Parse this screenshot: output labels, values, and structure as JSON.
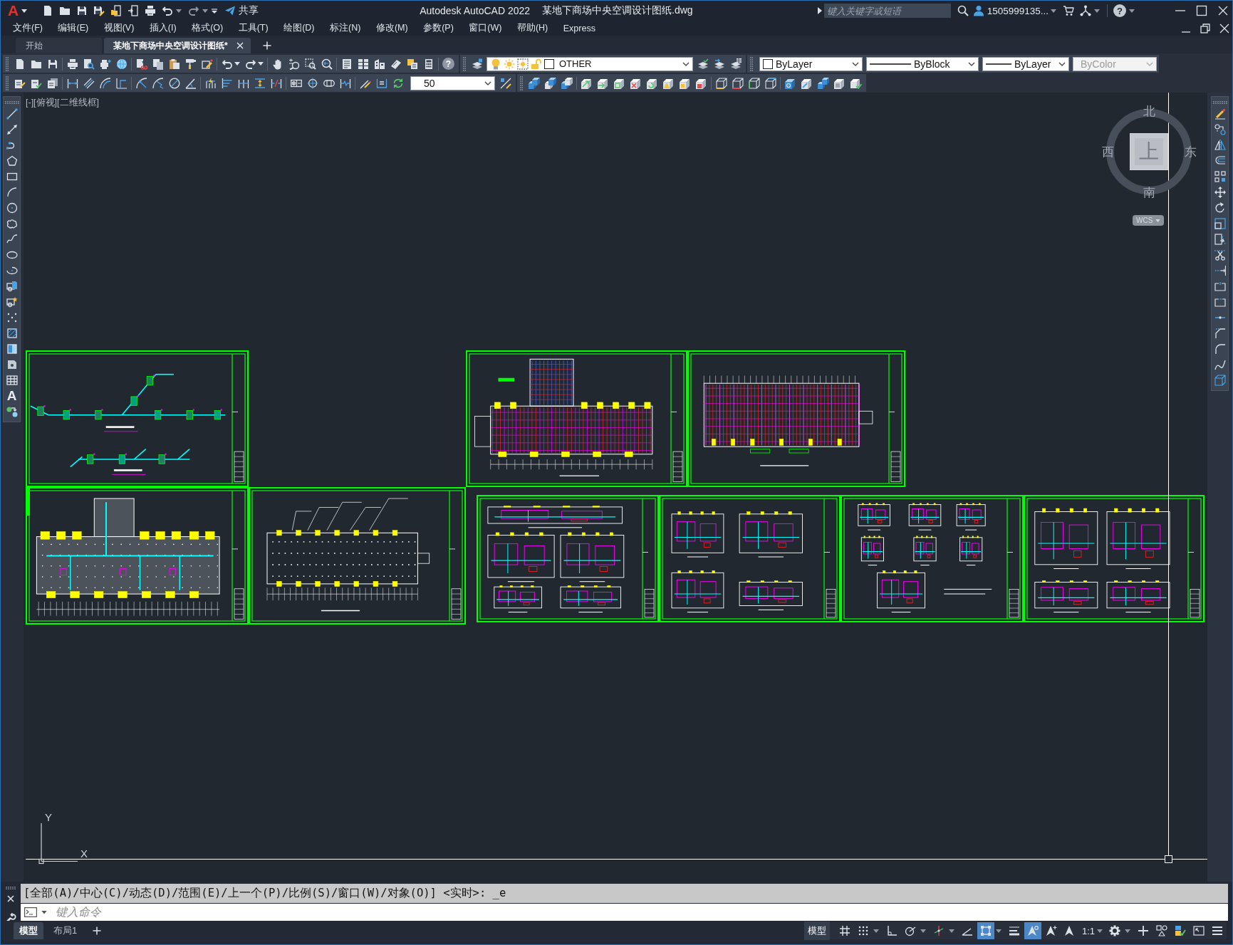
{
  "title_bar": {
    "logo": "A",
    "share_label": "共享",
    "app_name": "Autodesk AutoCAD 2022",
    "file_name": "某地下商场中央空调设计图纸.dwg",
    "search": {
      "placeholder": "键入关键字或短语"
    },
    "user_name": "1505999135...",
    "help": "?"
  },
  "menu_bar": [
    "文件(F)",
    "编辑(E)",
    "视图(V)",
    "插入(I)",
    "格式(O)",
    "工具(T)",
    "绘图(D)",
    "标注(N)",
    "修改(M)",
    "参数(P)",
    "窗口(W)",
    "帮助(H)",
    "Express"
  ],
  "document_tabs": [
    {
      "label": "开始",
      "selected": false
    },
    {
      "label": "某地下商场中央空调设计图纸*",
      "selected": true
    }
  ],
  "toolbars": {
    "help": "?",
    "layer": {
      "name": "OTHER",
      "on": true,
      "frozen": false,
      "locked": false
    },
    "color_control": "ByLayer",
    "linetype": "ByBlock",
    "lineweight": "ByLayer",
    "plot_style": {
      "value": "ByColor",
      "disabled": true
    },
    "dimension_style": "50"
  },
  "draw_toolbar": {
    "text_tool": "A"
  },
  "viewport": {
    "label": "[-][俯视][二维线框]",
    "viewcube": {
      "north": "北",
      "west": "西",
      "east": "东",
      "south": "南",
      "face": "上",
      "coordinate_system": "WCS"
    },
    "ucs_axes": {
      "y": "Y",
      "x": "X"
    }
  },
  "command_line": {
    "history": "[全部(A)/中心(C)/动态(D)/范围(E)/上一个(P)/比例(S)/窗口(W)/对象(O)] <实时>: _e",
    "placeholder": "键入命令"
  },
  "layout_tabs": [
    {
      "label": "模型",
      "selected": true
    },
    {
      "label": "布局1",
      "selected": false
    }
  ],
  "status_bar": {
    "space": "模型",
    "toggles": [
      {
        "kind": "grid",
        "on": false
      },
      {
        "kind": "snap",
        "on": false
      },
      {
        "kind": "ortho",
        "on": false
      },
      {
        "kind": "polar",
        "on": false
      },
      {
        "kind": "isodraft",
        "on": false
      },
      {
        "kind": "tracking",
        "on": false
      },
      {
        "kind": "osnap",
        "on": true
      },
      {
        "kind": "lineweight",
        "on": false
      },
      {
        "kind": "annotation_visibility",
        "on": true
      },
      {
        "kind": "autoscale",
        "on": false
      }
    ],
    "annotation_scale": "1:1"
  }
}
